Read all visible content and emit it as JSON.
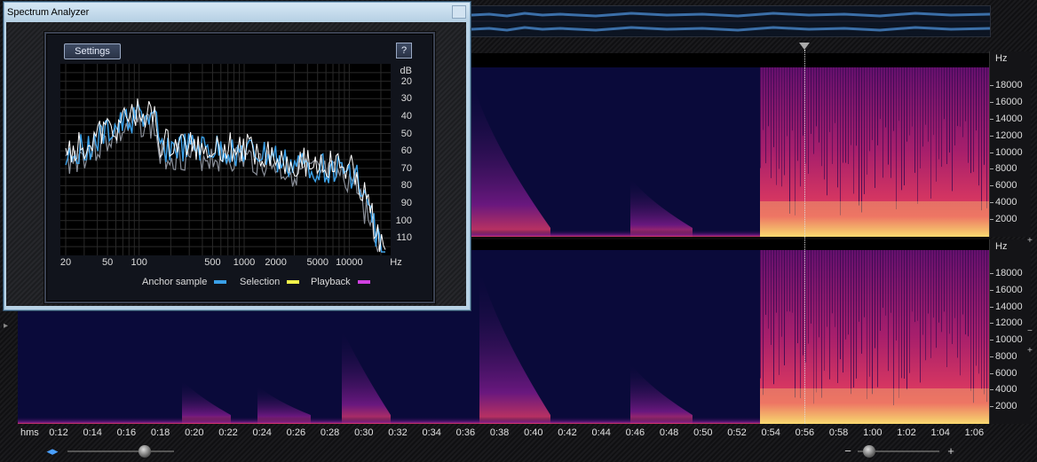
{
  "window": {
    "title": "Spectrum Analyzer",
    "settings_label": "Settings",
    "help_label": "?"
  },
  "analyzer": {
    "db_unit": "dB",
    "db_ticks": [
      "20",
      "30",
      "40",
      "50",
      "60",
      "70",
      "80",
      "90",
      "100",
      "110"
    ],
    "hz_ticks": [
      "20",
      "50",
      "100",
      "500",
      "1000",
      "2000",
      "5000",
      "10000",
      "Hz"
    ],
    "legend": [
      {
        "label": "Anchor sample",
        "color": "#3aa0e8"
      },
      {
        "label": "Selection",
        "color": "#f2f24a"
      },
      {
        "label": "Playback",
        "color": "#d040e0"
      }
    ],
    "anchor_color": "#3aa0e8",
    "playback_color": "#ffffff"
  },
  "freq_scale": {
    "unit": "Hz",
    "ticks": [
      "18000",
      "16000",
      "14000",
      "12000",
      "10000",
      "8000",
      "6000",
      "4000",
      "2000"
    ]
  },
  "time_ruler": {
    "unit": "hms",
    "ticks": [
      "0:12",
      "0:14",
      "0:16",
      "0:18",
      "0:20",
      "0:22",
      "0:24",
      "0:26",
      "0:28",
      "0:30",
      "0:32",
      "0:34",
      "0:36",
      "0:38",
      "0:40",
      "0:42",
      "0:44",
      "0:46",
      "0:48",
      "0:50",
      "0:52",
      "0:54",
      "0:56",
      "0:58",
      "1:00",
      "1:02",
      "1:04",
      "1:06"
    ]
  },
  "icons": {
    "zoom_out": "−",
    "zoom_in": "+",
    "collapse": "▸",
    "scroll_arrows": "◂▸"
  },
  "colors": {
    "spectrogram_low": "#0a0a3a",
    "spectrogram_mid": "#7a1a8a",
    "spectrogram_high": "#f04060",
    "spectrogram_peak": "#ffe070"
  }
}
